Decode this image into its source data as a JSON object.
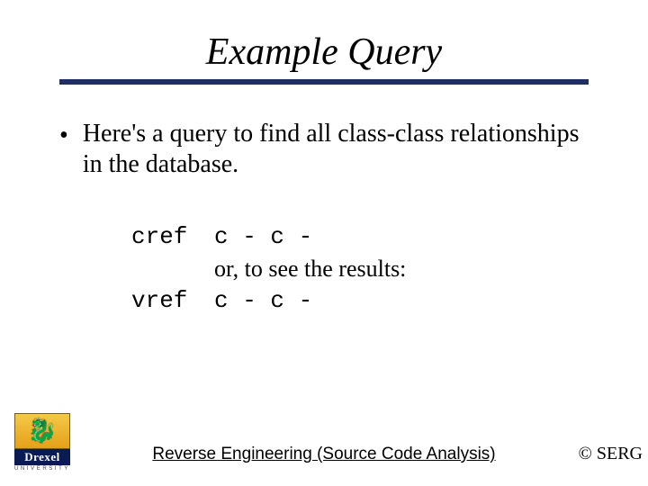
{
  "title": "Example Query",
  "bullet": "Here's a query to find all class-class relationships in the database.",
  "code": {
    "line1_cmd": "cref",
    "line1_args": "c - c -",
    "middle": "or, to see the results:",
    "line2_cmd": "vref",
    "line2_args": "c - c -"
  },
  "footer": "Reverse Engineering (Source Code Analysis)",
  "copyright": "© SERG",
  "logo": {
    "name": "Drexel",
    "sub": "UNIVERSITY"
  }
}
